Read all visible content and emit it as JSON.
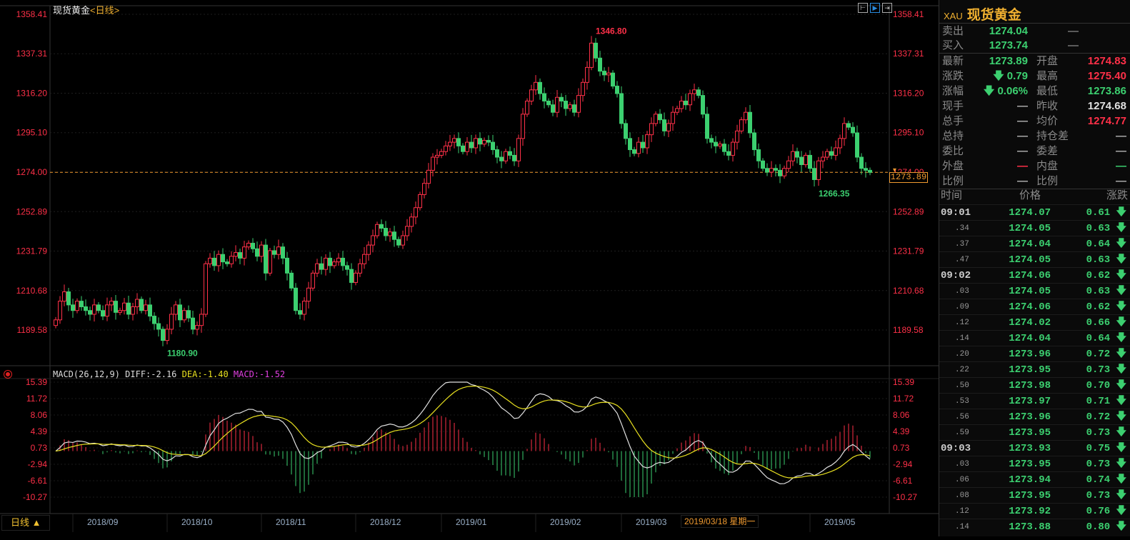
{
  "header": {
    "instrument": "现货黄金",
    "period": "<日线>"
  },
  "toolbar": [
    {
      "icon": "crosshair-left-icon",
      "label": "⊢"
    },
    {
      "icon": "play-right-icon",
      "label": "▶"
    },
    {
      "icon": "shift-right-icon",
      "label": "⇥"
    }
  ],
  "colors": {
    "up": "#ff3048",
    "down": "#3cd070",
    "dea": "#e8e020",
    "diff": "#e0e0e0",
    "accent": "#f09a30"
  },
  "chart_data": [
    {
      "type": "candlestick",
      "title": "现货黄金<日线>",
      "yticks": [
        "1358.41",
        "1337.31",
        "1316.20",
        "1295.10",
        "1274.00",
        "1252.89",
        "1231.79",
        "1210.68",
        "1189.58"
      ],
      "ylim": [
        1189.58,
        1358.41
      ],
      "xticks": [
        "2018/09",
        "2018/10",
        "2018/11",
        "2018/12",
        "2019/01",
        "2019/02",
        "2019/03",
        "2019/05"
      ],
      "xtick_index": [
        9,
        31,
        53,
        75,
        95,
        117,
        137,
        181
      ],
      "close": [
        1195,
        1205,
        1210,
        1203,
        1200,
        1205,
        1202,
        1200,
        1198,
        1203,
        1200,
        1197,
        1203,
        1205,
        1199,
        1200,
        1204,
        1198,
        1202,
        1206,
        1200,
        1203,
        1197,
        1193,
        1190,
        1184,
        1190,
        1198,
        1203,
        1195,
        1200,
        1196,
        1190,
        1192,
        1198,
        1225,
        1228,
        1224,
        1230,
        1226,
        1225,
        1229,
        1231,
        1228,
        1234,
        1236,
        1233,
        1229,
        1235,
        1220,
        1232,
        1230,
        1234,
        1228,
        1220,
        1212,
        1200,
        1198,
        1205,
        1212,
        1220,
        1225,
        1222,
        1228,
        1224,
        1226,
        1228,
        1224,
        1222,
        1215,
        1220,
        1225,
        1230,
        1235,
        1240,
        1246,
        1244,
        1240,
        1242,
        1238,
        1235,
        1240,
        1245,
        1250,
        1255,
        1262,
        1268,
        1275,
        1282,
        1283,
        1285,
        1288,
        1290,
        1292,
        1288,
        1285,
        1290,
        1287,
        1292,
        1289,
        1291,
        1290,
        1286,
        1282,
        1280,
        1285,
        1283,
        1280,
        1292,
        1305,
        1312,
        1318,
        1322,
        1316,
        1312,
        1310,
        1306,
        1314,
        1312,
        1308,
        1310,
        1306,
        1315,
        1322,
        1330,
        1343,
        1335,
        1328,
        1326,
        1327,
        1320,
        1316,
        1300,
        1292,
        1286,
        1284,
        1290,
        1287,
        1294,
        1300,
        1305,
        1302,
        1296,
        1300,
        1306,
        1308,
        1312,
        1310,
        1316,
        1318,
        1315,
        1305,
        1292,
        1290,
        1288,
        1289,
        1285,
        1283,
        1290,
        1296,
        1302,
        1306,
        1295,
        1286,
        1280,
        1276,
        1274,
        1276,
        1275,
        1272,
        1276,
        1280,
        1285,
        1282,
        1278,
        1283,
        1276,
        1270,
        1280,
        1282,
        1285,
        1283,
        1287,
        1292,
        1300,
        1298,
        1295,
        1282,
        1276,
        1275,
        1273.89
      ],
      "annotations": [
        {
          "text": "1346.80",
          "index": 125,
          "kind": "high"
        },
        {
          "text": "1180.90",
          "index": 25,
          "kind": "low"
        },
        {
          "text": "1266.35",
          "index": 177,
          "kind": "low"
        }
      ],
      "current_price": "1273.89",
      "reference_line": "1274.00"
    },
    {
      "type": "macd",
      "params": "MACD(26,12,9)",
      "diff_label": "DIFF:-2.16",
      "dea_label": "DEA:-1.40",
      "macd_label": "MACD:-1.52",
      "yticks": [
        "15.39",
        "11.72",
        "8.06",
        "4.39",
        "0.73",
        "-2.94",
        "-6.61",
        "-10.27"
      ],
      "ylim": [
        -10.27,
        15.39
      ]
    }
  ],
  "footer": {
    "period_button": "日线 ▲",
    "date_tip": "2019/03/18 星期一"
  },
  "quote": {
    "code": "XAU",
    "name": "现货黄金",
    "sell": {
      "label": "卖出",
      "price": "1274.04",
      "vol": "—"
    },
    "buy": {
      "label": "买入",
      "price": "1273.74",
      "vol": "—"
    },
    "rows": [
      {
        "l1": "最新",
        "v1": "1273.89",
        "c1": "g",
        "l2": "开盘",
        "v2": "1274.83",
        "c2": "r"
      },
      {
        "l1": "涨跌",
        "v1": "🡇 0.79",
        "c1": "g",
        "l2": "最高",
        "v2": "1275.40",
        "c2": "r"
      },
      {
        "l1": "涨幅",
        "v1": "🡇 0.06%",
        "c1": "g",
        "l2": "最低",
        "v2": "1273.86",
        "c2": "g"
      },
      {
        "l1": "现手",
        "v1": "—",
        "c1": "dim",
        "l2": "昨收",
        "v2": "1274.68",
        "c2": "w"
      },
      {
        "l1": "总手",
        "v1": "—",
        "c1": "dim",
        "l2": "均价",
        "v2": "1274.77",
        "c2": "r"
      },
      {
        "l1": "总持",
        "v1": "—",
        "c1": "dim",
        "l2": "持仓差",
        "v2": "—",
        "c2": "dim"
      },
      {
        "l1": "委比",
        "v1": "—",
        "c1": "dim",
        "l2": "委差",
        "v2": "—",
        "c2": "dim"
      },
      {
        "l1": "外盘",
        "v1": "—",
        "c1": "r",
        "l2": "内盘",
        "v2": "—",
        "c2": "g"
      },
      {
        "l1": "比例",
        "v1": "—",
        "c1": "dim",
        "l2": "比例",
        "v2": "—",
        "c2": "dim"
      }
    ]
  },
  "ticks": {
    "headers": [
      "时间",
      "价格",
      "涨跌"
    ],
    "rows": [
      {
        "t": "09:01",
        "p": "1274.07",
        "c": "0.61"
      },
      {
        "t": ".34",
        "p": "1274.05",
        "c": "0.63"
      },
      {
        "t": ".37",
        "p": "1274.04",
        "c": "0.64"
      },
      {
        "t": ".47",
        "p": "1274.05",
        "c": "0.63"
      },
      {
        "t": "09:02",
        "p": "1274.06",
        "c": "0.62"
      },
      {
        "t": ".03",
        "p": "1274.05",
        "c": "0.63"
      },
      {
        "t": ".09",
        "p": "1274.06",
        "c": "0.62"
      },
      {
        "t": ".12",
        "p": "1274.02",
        "c": "0.66"
      },
      {
        "t": ".14",
        "p": "1274.04",
        "c": "0.64"
      },
      {
        "t": ".20",
        "p": "1273.96",
        "c": "0.72"
      },
      {
        "t": ".22",
        "p": "1273.95",
        "c": "0.73"
      },
      {
        "t": ".50",
        "p": "1273.98",
        "c": "0.70"
      },
      {
        "t": ".53",
        "p": "1273.97",
        "c": "0.71"
      },
      {
        "t": ".56",
        "p": "1273.96",
        "c": "0.72"
      },
      {
        "t": ".59",
        "p": "1273.95",
        "c": "0.73"
      },
      {
        "t": "09:03",
        "p": "1273.93",
        "c": "0.75"
      },
      {
        "t": ".03",
        "p": "1273.95",
        "c": "0.73"
      },
      {
        "t": ".06",
        "p": "1273.94",
        "c": "0.74"
      },
      {
        "t": ".08",
        "p": "1273.95",
        "c": "0.73"
      },
      {
        "t": ".12",
        "p": "1273.92",
        "c": "0.76"
      },
      {
        "t": ".14",
        "p": "1273.88",
        "c": "0.80"
      }
    ]
  }
}
